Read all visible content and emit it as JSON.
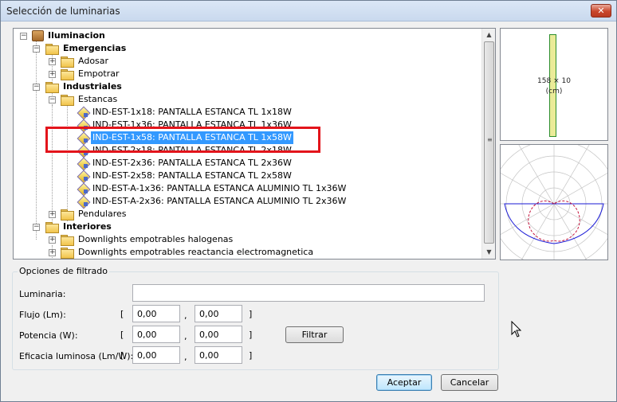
{
  "window": {
    "title": "Selección de luminarias",
    "close_label": "✕"
  },
  "tree": {
    "rows": [
      {
        "label": "Iluminacion",
        "bold": true
      },
      {
        "label": "Emergencias",
        "bold": true
      },
      {
        "label": "Adosar"
      },
      {
        "label": "Empotrar"
      },
      {
        "label": "Industriales",
        "bold": true
      },
      {
        "label": "Estancas"
      },
      {
        "label": "IND-EST-1x18: PANTALLA ESTANCA TL 1x18W"
      },
      {
        "label": "IND-EST-1x36: PANTALLA ESTANCA TL 1x36W"
      },
      {
        "label": "IND-EST-1x58: PANTALLA ESTANCA TL 1x58W",
        "selected": true
      },
      {
        "label": "IND-EST-2x18: PANTALLA ESTANCA TL 2x18W"
      },
      {
        "label": "IND-EST-2x36: PANTALLA ESTANCA TL 2x36W"
      },
      {
        "label": "IND-EST-2x58: PANTALLA ESTANCA TL 2x58W"
      },
      {
        "label": "IND-EST-A-1x36: PANTALLA ESTANCA ALUMINIO TL 1x36W"
      },
      {
        "label": "IND-EST-A-2x36: PANTALLA ESTANCA ALUMINIO TL 2x36W"
      },
      {
        "label": "Pendulares"
      },
      {
        "label": "Interiores",
        "bold": true
      },
      {
        "label": "Downlights empotrables halogenas"
      },
      {
        "label": "Downlights empotrables reactancia electromagnetica"
      }
    ]
  },
  "preview": {
    "dimension_line1": "158 × 10",
    "dimension_line2": "(cm)"
  },
  "filter": {
    "group_title": "Opciones de filtrado",
    "luminaria_label": "Luminaria:",
    "luminaria_value": "",
    "flujo_label": "Flujo (Lm):",
    "flujo_min": "0,00",
    "flujo_max": "0,00",
    "potencia_label": "Potencia (W):",
    "potencia_min": "0,00",
    "potencia_max": "0,00",
    "eficacia_label": "Eficacia luminosa (Lm/W):",
    "eficacia_min": "0,00",
    "eficacia_max": "0,00",
    "open_bracket": "[",
    "close_bracket": "]",
    "separator": ",",
    "filter_button": "Filtrar"
  },
  "buttons": {
    "accept": "Aceptar",
    "cancel": "Cancelar"
  },
  "colors": {
    "selection": "#3399ff",
    "highlight": "#e3141b"
  }
}
